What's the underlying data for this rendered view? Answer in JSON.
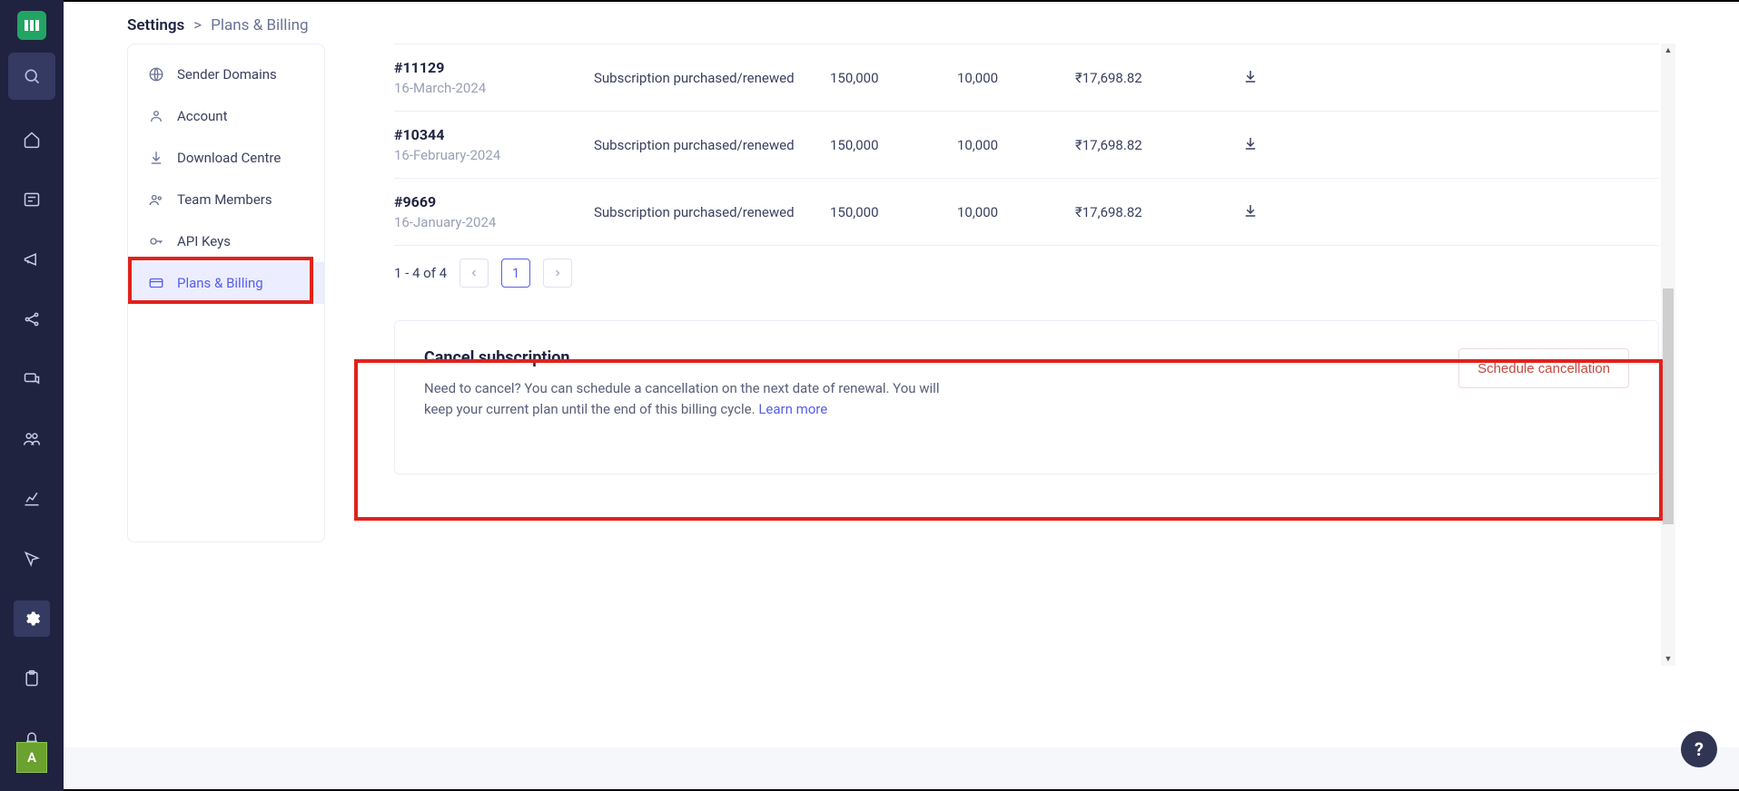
{
  "rail": {
    "logo_label": "||",
    "avatar_initial": "A"
  },
  "breadcrumb": {
    "root": "Settings",
    "sep": ">",
    "current": "Plans & Billing"
  },
  "sidebar": {
    "items": [
      {
        "label": "Sender Domains"
      },
      {
        "label": "Account"
      },
      {
        "label": "Download Centre"
      },
      {
        "label": "Team Members"
      },
      {
        "label": "API Keys"
      },
      {
        "label": "Plans & Billing"
      }
    ]
  },
  "invoices": [
    {
      "id": "#11129",
      "date": "16-March-2024",
      "desc": "Subscription purchased/renewed",
      "v1": "150,000",
      "v2": "10,000",
      "amount": "₹17,698.82"
    },
    {
      "id": "#10344",
      "date": "16-February-2024",
      "desc": "Subscription purchased/renewed",
      "v1": "150,000",
      "v2": "10,000",
      "amount": "₹17,698.82"
    },
    {
      "id": "#9669",
      "date": "16-January-2024",
      "desc": "Subscription purchased/renewed",
      "v1": "150,000",
      "v2": "10,000",
      "amount": "₹17,698.82"
    }
  ],
  "pagination": {
    "range": "1 - 4 of 4",
    "page": "1"
  },
  "cancel": {
    "title": "Cancel subscription",
    "body": "Need to cancel? You can schedule a cancellation on the next date of renewal. You will keep your current plan until the end of this billing cycle. ",
    "learn": "Learn more",
    "button": "Schedule cancellation"
  },
  "help": {
    "label": "?"
  }
}
